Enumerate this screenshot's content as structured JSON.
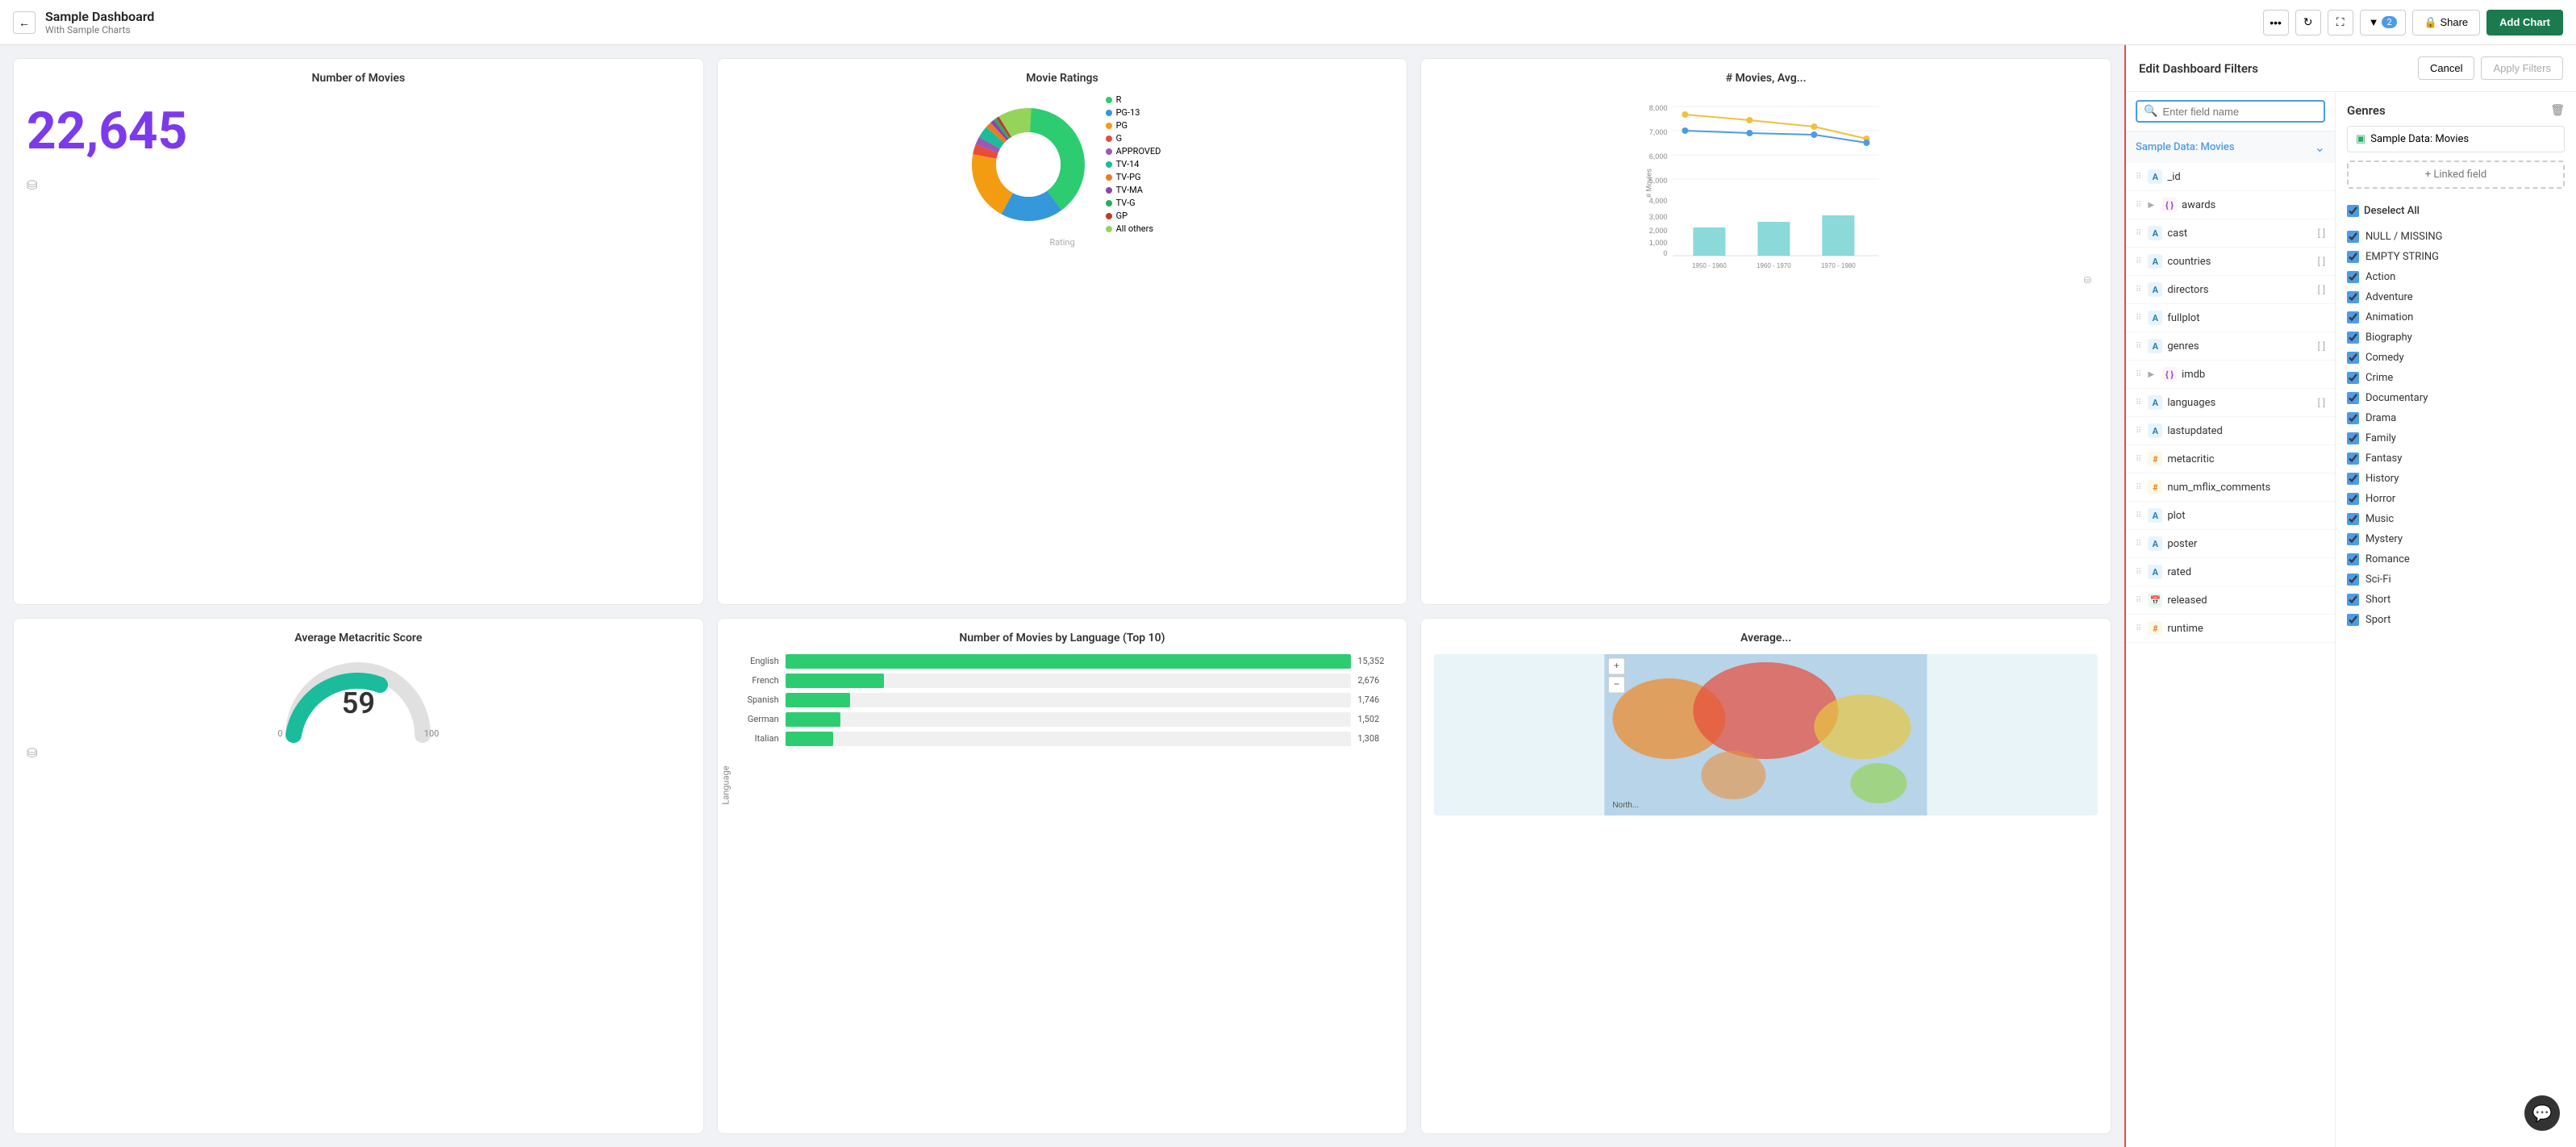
{
  "topbar": {
    "back_label": "←",
    "title": "Sample Dashboard",
    "subtitle": "With Sample Charts",
    "more_label": "•••",
    "refresh_label": "↻",
    "fullscreen_label": "⛶",
    "filter_label": "▼",
    "filter_count": "2",
    "share_label": "🔒 Share",
    "add_chart_label": "Add Chart"
  },
  "panel": {
    "title": "Edit Dashboard Filters",
    "cancel_label": "Cancel",
    "apply_label": "Apply Filters",
    "search_placeholder": "Enter field name",
    "datasource_label": "Sample Data: Movies",
    "fields": [
      {
        "name": "_id",
        "type": "string",
        "expandable": false
      },
      {
        "name": "awards",
        "type": "object",
        "expandable": true
      },
      {
        "name": "cast",
        "type": "string",
        "expandable": false
      },
      {
        "name": "countries",
        "type": "string",
        "expandable": false
      },
      {
        "name": "directors",
        "type": "string",
        "expandable": false
      },
      {
        "name": "fullplot",
        "type": "string",
        "expandable": false
      },
      {
        "name": "genres",
        "type": "string",
        "expandable": false
      },
      {
        "name": "imdb",
        "type": "object",
        "expandable": true
      },
      {
        "name": "languages",
        "type": "string",
        "expandable": false
      },
      {
        "name": "lastupdated",
        "type": "string",
        "expandable": false
      },
      {
        "name": "metacritic",
        "type": "number",
        "expandable": false
      },
      {
        "name": "num_mflix_comments",
        "type": "number",
        "expandable": false
      },
      {
        "name": "plot",
        "type": "string",
        "expandable": false
      },
      {
        "name": "poster",
        "type": "string",
        "expandable": false
      },
      {
        "name": "rated",
        "type": "string",
        "expandable": false
      },
      {
        "name": "released",
        "type": "date",
        "expandable": false
      },
      {
        "name": "runtime",
        "type": "number",
        "expandable": false
      }
    ],
    "filter_title": "Genres",
    "datasource_tag": "Sample Data: Movies",
    "linked_field_label": "+ Linked field",
    "deselect_label": "Deselect All",
    "options": [
      {
        "label": "NULL / MISSING",
        "checked": true
      },
      {
        "label": "EMPTY STRING",
        "checked": true
      },
      {
        "label": "Action",
        "checked": true
      },
      {
        "label": "Adventure",
        "checked": true
      },
      {
        "label": "Animation",
        "checked": true
      },
      {
        "label": "Biography",
        "checked": true
      },
      {
        "label": "Comedy",
        "checked": true
      },
      {
        "label": "Crime",
        "checked": true
      },
      {
        "label": "Documentary",
        "checked": true
      },
      {
        "label": "Drama",
        "checked": true
      },
      {
        "label": "Family",
        "checked": true
      },
      {
        "label": "Fantasy",
        "checked": true
      },
      {
        "label": "History",
        "checked": true
      },
      {
        "label": "Horror",
        "checked": true
      },
      {
        "label": "Music",
        "checked": true
      },
      {
        "label": "Mystery",
        "checked": true
      },
      {
        "label": "Romance",
        "checked": true
      },
      {
        "label": "Sci-Fi",
        "checked": true
      },
      {
        "label": "Short",
        "checked": true
      },
      {
        "label": "Sport",
        "checked": true
      }
    ]
  },
  "charts": {
    "num_movies": {
      "title": "Number of Movies",
      "value": "22,645"
    },
    "movie_ratings": {
      "title": "Movie Ratings",
      "legend": [
        {
          "label": "R",
          "color": "#2ecc71"
        },
        {
          "label": "PG-13",
          "color": "#3498db"
        },
        {
          "label": "PG",
          "color": "#f39c12"
        },
        {
          "label": "G",
          "color": "#e74c3c"
        },
        {
          "label": "APPROVED",
          "color": "#9b59b6"
        },
        {
          "label": "TV-14",
          "color": "#1abc9c"
        },
        {
          "label": "TV-PG",
          "color": "#e67e22"
        },
        {
          "label": "TV-MA",
          "color": "#8e44ad"
        },
        {
          "label": "TV-G",
          "color": "#27ae60"
        },
        {
          "label": "GP",
          "color": "#c0392b"
        },
        {
          "label": "All others",
          "color": "#95d45a"
        }
      ]
    },
    "movies_avg": {
      "title": "# Movies, Avg..."
    },
    "avg_metacritic": {
      "title": "Average Metacritic Score",
      "value": "59",
      "min": "0",
      "max": "100"
    },
    "by_language": {
      "title": "Number of Movies by Language (Top 10)",
      "bars": [
        {
          "label": "English",
          "value": 15352,
          "display": "15,352"
        },
        {
          "label": "French",
          "value": 2676,
          "display": "2,676"
        },
        {
          "label": "Spanish",
          "value": 1746,
          "display": "1,746"
        },
        {
          "label": "German",
          "value": 1502,
          "display": "1,502"
        },
        {
          "label": "Italian",
          "value": 1308,
          "display": "1,308"
        }
      ],
      "max_value": 15352
    },
    "average_map": {
      "title": "Average..."
    }
  }
}
